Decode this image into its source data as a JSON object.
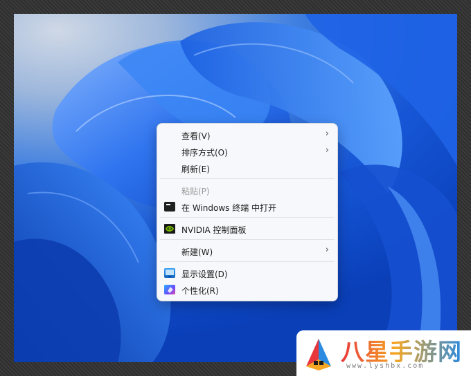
{
  "context_menu": {
    "items": [
      {
        "label": "查看(V)",
        "icon": "",
        "submenu": true,
        "disabled": false
      },
      {
        "label": "排序方式(O)",
        "icon": "",
        "submenu": true,
        "disabled": false
      },
      {
        "label": "刷新(E)",
        "icon": "",
        "submenu": false,
        "disabled": false
      },
      {
        "label": "粘贴(P)",
        "icon": "",
        "submenu": false,
        "disabled": true
      },
      {
        "label": "在 Windows 终端 中打开",
        "icon": "terminal-icon",
        "submenu": false,
        "disabled": false
      },
      {
        "label": "NVIDIA 控制面板",
        "icon": "nvidia-icon",
        "submenu": false,
        "disabled": false
      },
      {
        "label": "新建(W)",
        "icon": "",
        "submenu": true,
        "disabled": false
      },
      {
        "label": "显示设置(D)",
        "icon": "display-icon",
        "submenu": false,
        "disabled": false
      },
      {
        "label": "个性化(R)",
        "icon": "personalize-icon",
        "submenu": false,
        "disabled": false
      }
    ],
    "submenu_glyph": "›"
  },
  "watermark": {
    "name": "八星手游网",
    "url": "www.lyshbx.com"
  },
  "colors": {
    "wallpaper_blue": "#1656d6",
    "menu_bg": "#f6f8fb",
    "disabled_text": "#9a9a9a"
  }
}
